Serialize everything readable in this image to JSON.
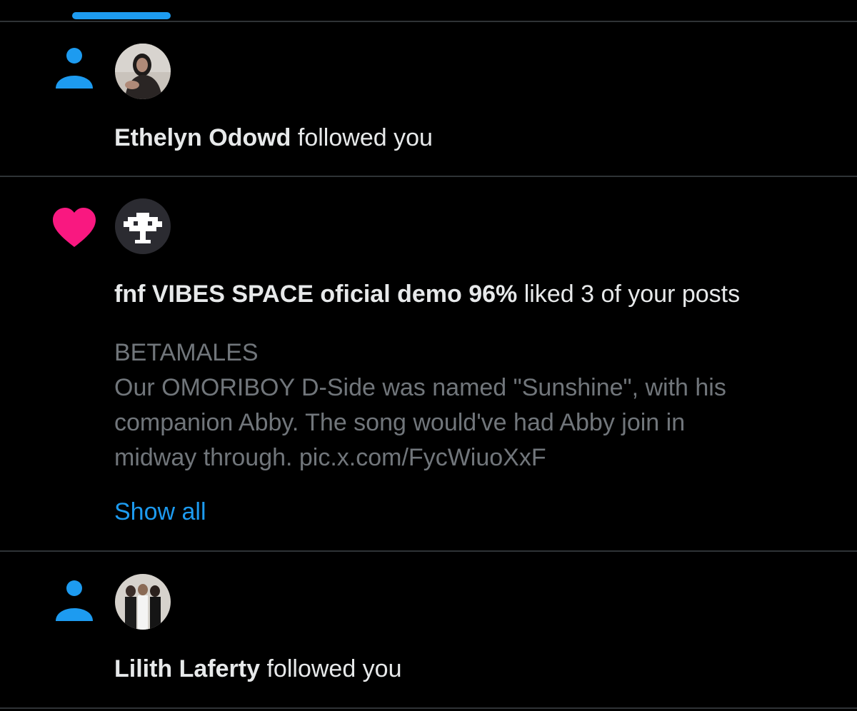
{
  "notifications": [
    {
      "type": "follow",
      "icon": "person-icon",
      "icon_color": "#1d9bf0",
      "user_name": "Ethelyn Odowd",
      "action": " followed you"
    },
    {
      "type": "like",
      "icon": "heart-icon",
      "icon_color": "#f91880",
      "user_name": "fnf VIBES SPACE oficial demo 96%",
      "action": " liked 3 of your posts",
      "post_lines": [
        "BETAMALES",
        "Our OMORIBOY D-Side was named \"Sunshine\", with his",
        "companion Abby. The song would've had Abby join in",
        "midway through. pic.x.com/FycWiuoXxF"
      ],
      "show_all_label": "Show all"
    },
    {
      "type": "follow",
      "icon": "person-icon",
      "icon_color": "#1d9bf0",
      "user_name": "Lilith Laferty",
      "action": " followed you"
    }
  ],
  "colors": {
    "background": "#000000",
    "divider": "#2f3336",
    "accent": "#1d9bf0",
    "like": "#f91880",
    "primary_text": "#e7e9ea",
    "secondary_text": "#71767b"
  }
}
